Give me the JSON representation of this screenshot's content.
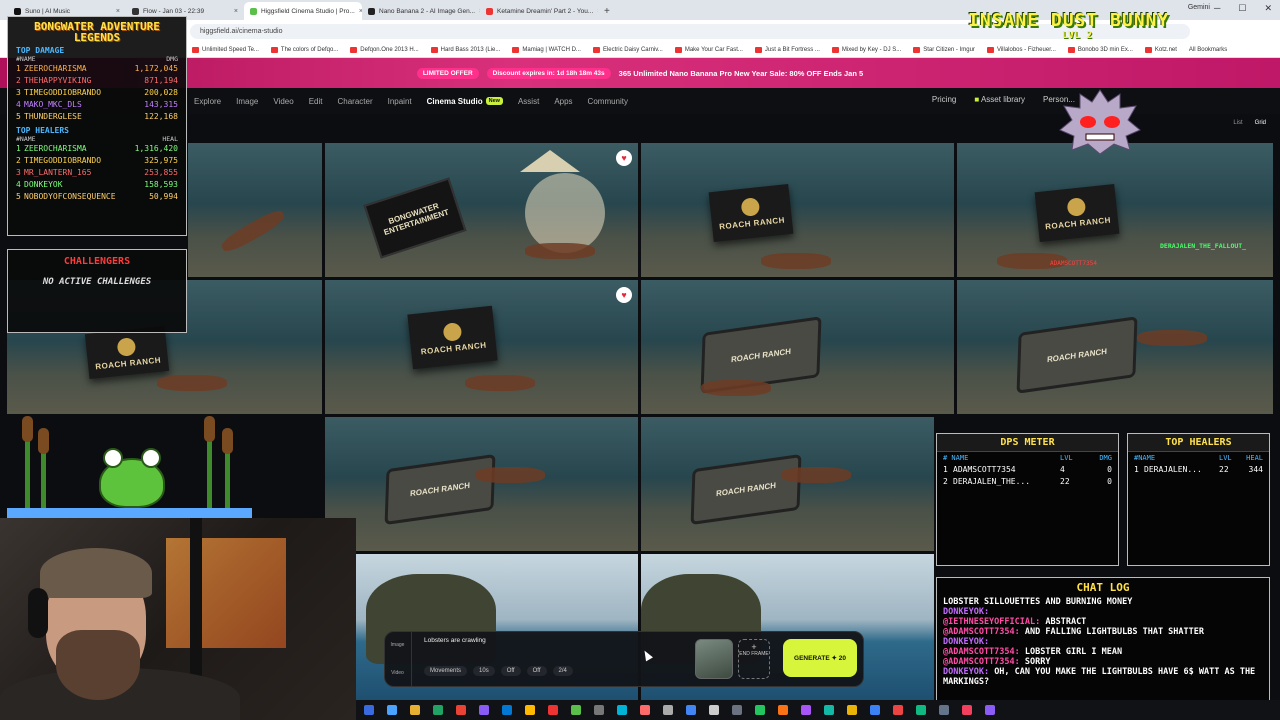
{
  "browser": {
    "tabs": [
      {
        "label": "Suno | AI Music",
        "color": "#111111"
      },
      {
        "label": "Flow - Jan 03 - 22:39",
        "color": "#333333"
      },
      {
        "label": "Higgsfield Cinema Studio | Pro...",
        "color": "#5bc04a",
        "active": true
      },
      {
        "label": "Nano Banana 2 - AI Image Gen...",
        "color": "#222222"
      },
      {
        "label": "Ketamine Dreamin' Part 2 - You...",
        "color": "#e33333"
      }
    ],
    "gemini_label": "Gemini",
    "url": "higgsfield.ai/cinema-studio",
    "bookmarks": [
      "Unlimited Speed Te...",
      "The colors of Defqo...",
      "Defqon.One 2013 H...",
      "Hard Bass 2013 (Lie...",
      "Mamiag | WATCH D...",
      "Electric Daisy Carniv...",
      "Make Your Car Fast...",
      "Just a Bit Fortress ...",
      "Mixed by Key - DJ S...",
      "Star Citizen - Imgur",
      "Villalobos - Fizheuer...",
      "Bonobo 3D min Ex...",
      "Kotz.net",
      "All Bookmarks"
    ]
  },
  "promo": {
    "limited_offer": "LIMITED OFFER",
    "discount": "Discount expires in: 1d 18h 18m 43s",
    "text": "365 Unlimited Nano Banana Pro New Year Sale: 80% OFF Ends Jan 5"
  },
  "nav": {
    "items": [
      "Explore",
      "Image",
      "Video",
      "Edit",
      "Character",
      "Inpaint",
      "Cinema Studio",
      "Assist",
      "Apps",
      "Community"
    ],
    "new_badge": "New",
    "pricing": "Pricing",
    "asset_library": "Asset library",
    "personal": "Person...",
    "view_list": "List",
    "view_grid": "Grid"
  },
  "tiles": {
    "sign_roach": "ROACH RANCH",
    "sign_bongwater": "BONGWATER ENTERTAINMENT"
  },
  "leaderboard": {
    "title_line1": "BONGWATER ADVENTURE",
    "title_line2": "LEGENDS",
    "damage_title": "TOP DAMAGE",
    "name_col": "#NAME",
    "dmg_col": "DMG",
    "damage_rows": [
      {
        "rank": "1",
        "name": "ZEEROCHARISMA",
        "value": "1,172,045",
        "color": "#ffb347"
      },
      {
        "rank": "2",
        "name": "THEHAPPYVIKING",
        "value": "871,194",
        "color": "#ff6b6b"
      },
      {
        "rank": "3",
        "name": "TIMEGODDIOBRANDO",
        "value": "200,028",
        "color": "#ffd24a"
      },
      {
        "rank": "4",
        "name": "MAKO_MKC_DLS",
        "value": "143,315",
        "color": "#c080ff"
      },
      {
        "rank": "5",
        "name": "THUNDERGLESE",
        "value": "122,168",
        "color": "#ffcf6a"
      }
    ],
    "healers_title": "TOP HEALERS",
    "heal_col": "HEAL",
    "healer_rows": [
      {
        "rank": "1",
        "name": "ZEEROCHARISMA",
        "value": "1,316,420",
        "color": "#7dff7d"
      },
      {
        "rank": "2",
        "name": "TIMEGODDIOBRANDO",
        "value": "325,975",
        "color": "#ffd24a"
      },
      {
        "rank": "3",
        "name": "MR_LANTERN_165",
        "value": "253,855",
        "color": "#ff6b6b"
      },
      {
        "rank": "4",
        "name": "DONKEYOK",
        "value": "158,593",
        "color": "#7dff7d"
      },
      {
        "rank": "5",
        "name": "NOBODYOFCONSEQUENCE",
        "value": "50,994",
        "color": "#ffcf6a"
      }
    ]
  },
  "challenges": {
    "title": "CHALLENGERS",
    "none": "NO ACTIVE CHALLENGES"
  },
  "boss": {
    "title": "INSANE DUST BUNNY",
    "level": "LVL 2"
  },
  "game_labels": {
    "player1": "ADAMSCOTT7354",
    "player2": "DERAJALEN_THE_FALLOUT_"
  },
  "dps": {
    "title": "DPS METER",
    "cols": [
      "# NAME",
      "LVL",
      "DMG"
    ],
    "rows": [
      {
        "rank": "1",
        "name": "ADAMSCOTT7354",
        "lvl": "4",
        "dmg": "0"
      },
      {
        "rank": "2",
        "name": "DERAJALEN_THE...",
        "lvl": "22",
        "dmg": "0"
      }
    ]
  },
  "healers2": {
    "title": "TOP HEALERS",
    "cols": [
      "#NAME",
      "LVL",
      "HEAL"
    ],
    "rows": [
      {
        "rank": "1",
        "name": "DERAJALEN...",
        "lvl": "22",
        "heal": "344"
      }
    ]
  },
  "chat": {
    "title": "CHAT LOG",
    "lines": [
      {
        "user": "",
        "msg": "LOBSTER SILLOUETTES AND BURNING MONEY"
      },
      {
        "user": "DONKEYOK:",
        "msg": ""
      },
      {
        "user": "@IETHNESEYOFFICIAL:",
        "msg": "ABSTRACT"
      },
      {
        "user": "@ADAMSCOTT7354:",
        "msg": "AND FALLING LIGHTBULBS THAT SHATTER"
      },
      {
        "user": "DONKEYOK:",
        "msg": ""
      },
      {
        "user": "@ADAMSCOTT7354:",
        "msg": "LOBSTER GIRL I MEAN"
      },
      {
        "user": "@ADAMSCOTT7354:",
        "msg": "SORRY"
      },
      {
        "user": "DONKEYOK:",
        "msg": "OH, CAN YOU MAKE THE LIGHTBULBS HAVE 6$ WATT AS THE MARKINGS?"
      }
    ]
  },
  "prompt": {
    "text": "Lobsters are crawling",
    "mode_image": "Image",
    "mode_video": "Video",
    "movements": "Movements",
    "duration": "10s",
    "audio": "Off",
    "option_off": "Off",
    "count": "2/4",
    "end_frame": "END FRAME",
    "generate": "GENERATE ✦ 20"
  }
}
